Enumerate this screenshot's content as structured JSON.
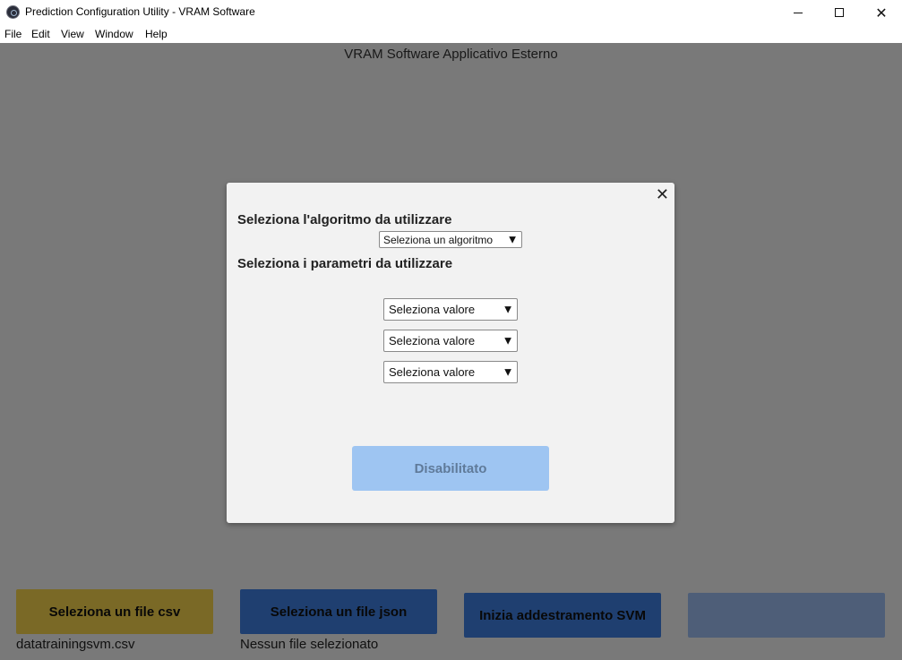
{
  "window": {
    "title": "Prediction Configuration Utility - VRAM Software",
    "close_glyph": "✕"
  },
  "menu": [
    "File",
    "Edit",
    "View",
    "Window",
    "Help"
  ],
  "app": {
    "header": "VRAM Software Applicativo Esterno",
    "buttons": {
      "csv": "Seleziona un file csv",
      "json": "Seleziona un file json",
      "svm": "Inizia addestramento SVM",
      "extra": ""
    },
    "status": {
      "csv": "datatrainingsvm.csv",
      "json": "Nessun file selezionato"
    },
    "colors": {
      "csv_button": "#f5d24d",
      "json_button": "#3f7fe0",
      "svm_button": "#3f7fe0",
      "extra_button": "#9cbcf0"
    }
  },
  "modal": {
    "close_glyph": "✕",
    "algorithm_heading": "Seleziona l'algoritmo da utilizzare",
    "algorithm_select": "Seleziona un algoritmo",
    "parameters_heading": "Seleziona i parametri da utilizzare",
    "parameter_selects": [
      "Seleziona valore",
      "Seleziona valore",
      "Seleziona valore"
    ],
    "submit_label": "Disabilitato",
    "dropdown_arrow": "▼"
  }
}
